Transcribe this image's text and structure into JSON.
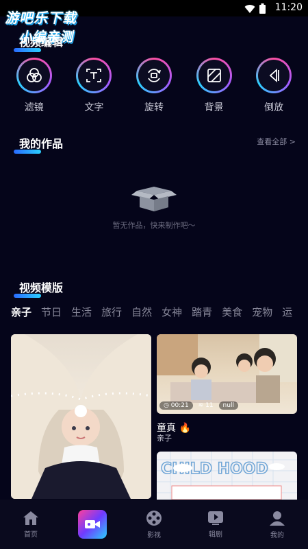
{
  "status": {
    "time": "11:20"
  },
  "watermark": {
    "line1": "游吧乐下载",
    "line2": "小编亲测"
  },
  "sections": {
    "video_edit": "视频编辑",
    "my_works": "我的作品",
    "templates": "视频模版"
  },
  "tools": [
    {
      "label": "滤镜",
      "icon": "filter-icon"
    },
    {
      "label": "文字",
      "icon": "text-icon"
    },
    {
      "label": "旋转",
      "icon": "rotate-icon"
    },
    {
      "label": "背景",
      "icon": "background-icon"
    },
    {
      "label": "倒放",
      "icon": "reverse-icon"
    }
  ],
  "my_works": {
    "view_all": "查看全部 >",
    "empty_text": "暂无作品，快来制作吧～"
  },
  "tabs": [
    "亲子",
    "节日",
    "生活",
    "旅行",
    "自然",
    "女神",
    "踏青",
    "美食",
    "宠物",
    "运"
  ],
  "cards": [
    {
      "title": "童真",
      "subtitle": "亲子",
      "duration": "00:21",
      "count": "11",
      "extra": "null"
    },
    {
      "art_text": "CHILD HOOD"
    }
  ],
  "nav": [
    {
      "label": "首页",
      "icon": "home-icon"
    },
    {
      "label": "",
      "icon": "video-camera-icon"
    },
    {
      "label": "影视",
      "icon": "film-reel-icon"
    },
    {
      "label": "辑剧",
      "icon": "play-icon"
    },
    {
      "label": "我的",
      "icon": "user-icon"
    }
  ],
  "colors": {
    "background": "#05051a",
    "accent_pink": "#ff4fa3",
    "accent_blue": "#2bd0ff"
  }
}
